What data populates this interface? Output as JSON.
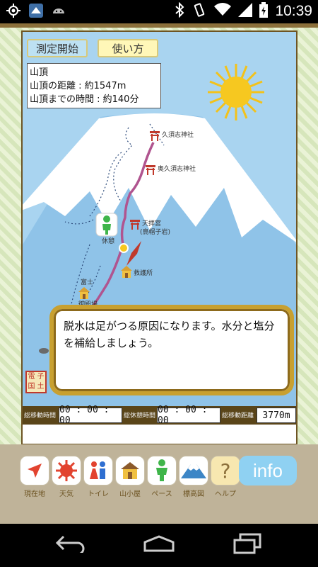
{
  "status": {
    "time": "10:39",
    "icons": [
      "location-icon",
      "app-notification-icon",
      "android-icon",
      "bluetooth-icon",
      "vibrate-icon",
      "wifi-icon",
      "signal-icon",
      "battery-icon"
    ]
  },
  "map": {
    "buttons": {
      "measure_start": "測定開始",
      "how_to": "使い方"
    },
    "info": {
      "title": "山頂",
      "distance": "山頂の距離 : 約1547m",
      "time": "山頂までの時間 : 約140分"
    },
    "labels": {
      "shrine1": "久須志神社",
      "shrine2": "奥久須志神社",
      "shrine3_line1": "天拝宮",
      "shrine3_line2": "(鳥帽子岩)",
      "rest": "休憩",
      "rescue": "救護所",
      "hut_line1": "富士",
      "hut_line2": "御殿場"
    },
    "message": "脱水は足がつる原因になります。水分と塩分を補給しましょう。",
    "badge": [
      "子",
      "電",
      "土",
      "国"
    ]
  },
  "timer": {
    "moving_label": "総移動時間",
    "moving_value": "00 : 00 : 00",
    "rest_label": "総休憩時間",
    "rest_value": "00 : 00 : 00",
    "distance_label": "総移動距離",
    "distance_value": "3770m"
  },
  "toolbar": {
    "items": [
      {
        "label": "現在地",
        "icon": "current-location-icon"
      },
      {
        "label": "天気",
        "icon": "weather-sun-icon"
      },
      {
        "label": "トイレ",
        "icon": "toilet-icon"
      },
      {
        "label": "山小屋",
        "icon": "mountain-hut-icon"
      },
      {
        "label": "ペース",
        "icon": "pace-hiker-icon"
      },
      {
        "label": "標高図",
        "icon": "elevation-chart-icon"
      },
      {
        "label": "ヘルプ",
        "icon": "help-icon"
      }
    ],
    "info_label": "info"
  },
  "colors": {
    "sky": "#a9d4f0",
    "snow": "#ffffff",
    "trail": "#b0548f",
    "frame": "#6e5524",
    "accent_blue": "#8fd1f2"
  }
}
